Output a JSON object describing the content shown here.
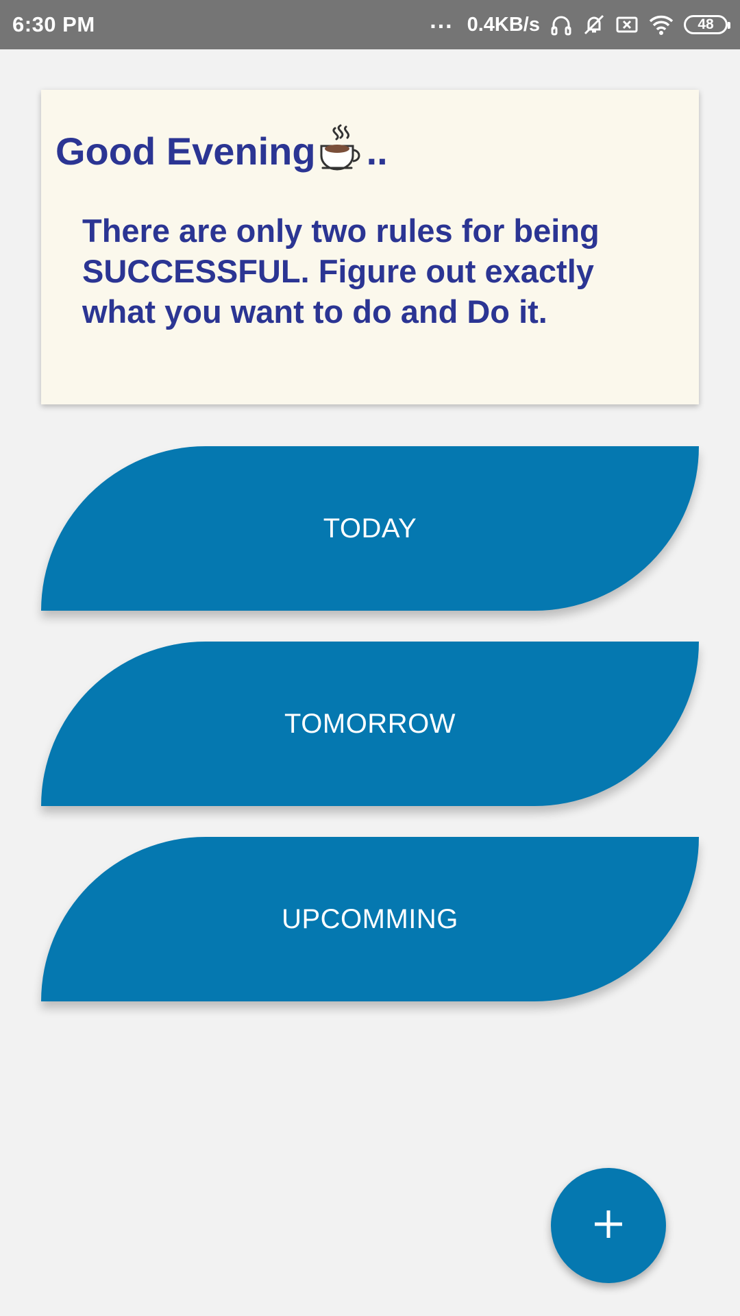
{
  "status_bar": {
    "time": "6:30 PM",
    "dots": "...",
    "net_speed": "0.4KB/s",
    "battery_level": "48",
    "icons": [
      "headphones-icon",
      "mute-vibrate-icon",
      "sim-error-icon",
      "wifi-icon",
      "battery-icon"
    ]
  },
  "quote_card": {
    "greeting": "Good Evening",
    "greeting_suffix": "..",
    "greeting_icon": "coffee-icon",
    "quote": "There are only two rules for being SUCCESSFUL. Figure out exactly what you want to do and Do it."
  },
  "buttons": {
    "today": "TODAY",
    "tomorrow": "TOMORROW",
    "upcoming": "UPCOMMING"
  },
  "fab": {
    "icon": "plus-icon"
  },
  "colors": {
    "status_bar": "#757575",
    "background": "#f2f2f2",
    "card": "#fbf8ec",
    "text_accent": "#2b3593",
    "primary": "#0578b0"
  }
}
